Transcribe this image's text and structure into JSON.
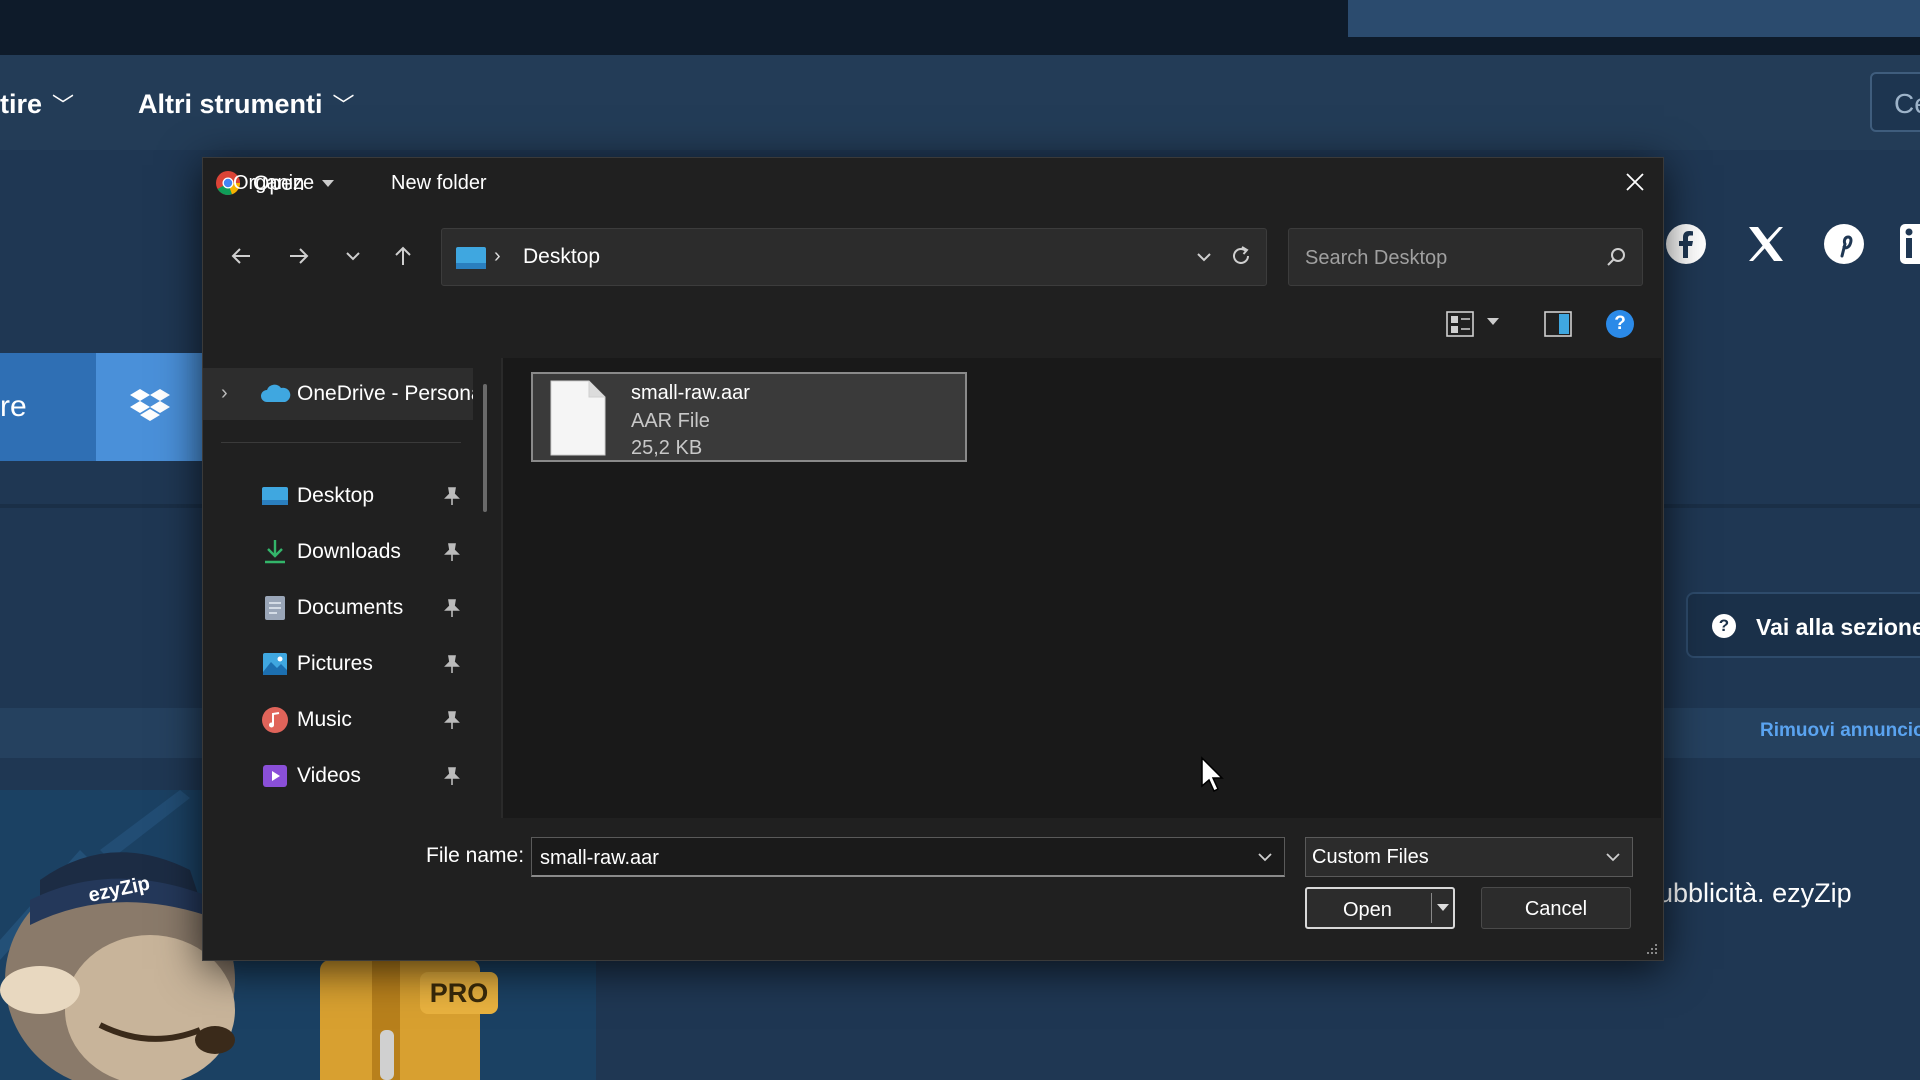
{
  "background": {
    "nav_items": [
      {
        "label": "tire"
      },
      {
        "label": "Altri strumenti"
      }
    ],
    "search_partial": "Ce",
    "upload_partial": "re",
    "section_button": "Vai alla sezione",
    "remove_ad": "Rimuovi annuncio",
    "promo_text": "ubblicità. ezyZip",
    "mascot_cap_text": "ezyZip",
    "pro_badge": "PRO",
    "social_icons": [
      "facebook-icon",
      "x-icon",
      "pinterest-icon",
      "linkedin-icon"
    ]
  },
  "dialog": {
    "title": "Open",
    "address": {
      "location": "Desktop"
    },
    "search": {
      "placeholder": "Search Desktop"
    },
    "commands": {
      "organize": "Organize",
      "new_folder": "New folder"
    },
    "sidebar": {
      "onedrive": "OneDrive - Personal",
      "quick_access": [
        {
          "label": "Desktop",
          "icon": "desktop-folder-icon"
        },
        {
          "label": "Downloads",
          "icon": "downloads-icon"
        },
        {
          "label": "Documents",
          "icon": "documents-icon"
        },
        {
          "label": "Pictures",
          "icon": "pictures-icon"
        },
        {
          "label": "Music",
          "icon": "music-icon"
        },
        {
          "label": "Videos",
          "icon": "videos-icon"
        }
      ]
    },
    "files": [
      {
        "name": "small-raw.aar",
        "type": "AAR File",
        "size": "25,2 KB"
      }
    ],
    "file_name_label": "File name:",
    "file_name_value": "small-raw.aar",
    "file_type": "Custom Files",
    "open_label": "Open",
    "cancel_label": "Cancel",
    "colors": {
      "dialog_bg": "#202020",
      "accent": "#2b8ae8",
      "site_bg": "#1f3753"
    }
  }
}
